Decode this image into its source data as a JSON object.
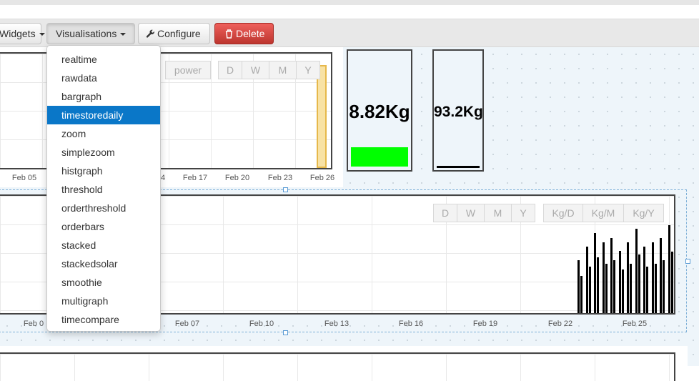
{
  "toolbar": {
    "widgets_label": "Widgets",
    "visualisations_label": "Visualisations",
    "configure_label": "Configure",
    "delete_label": "Delete"
  },
  "dropdown": {
    "items": [
      "realtime",
      "rawdata",
      "bargraph",
      "timestoredaily",
      "zoom",
      "simplezoom",
      "histgraph",
      "threshold",
      "orderthreshold",
      "orderbars",
      "stacked",
      "stackedsolar",
      "smoothie",
      "multigraph",
      "timecompare"
    ],
    "selected": "timestoredaily"
  },
  "graph1": {
    "power_label": "power",
    "range_buttons": [
      "D",
      "W",
      "M",
      "Y"
    ],
    "x_ticks": [
      "Feb 05",
      "Feb 14",
      "Feb 17",
      "Feb 20",
      "Feb 23",
      "Feb 26"
    ],
    "tick_4_visible": "4"
  },
  "feeds": [
    {
      "value": "8.82Kg",
      "bar_color": "#00ff00",
      "level": 0.35
    },
    {
      "value": "93.2Kg",
      "bar_color": "#000000",
      "level": 0.02
    }
  ],
  "graph2": {
    "range_buttons": [
      "D",
      "W",
      "M",
      "Y"
    ],
    "unit_buttons": [
      "Kg/D",
      "Kg/M",
      "Kg/Y"
    ],
    "x_ticks": [
      "Feb 0",
      "Feb 07",
      "Feb 10",
      "Feb 13",
      "Feb 16",
      "Feb 19",
      "Feb 22",
      "Feb 25"
    ]
  },
  "colors": {
    "accent": "#0a77c8",
    "danger": "#d9534f",
    "plot_border": "#444444"
  },
  "chart_data": {
    "type": "bar",
    "title": "",
    "xlabel": "",
    "ylabel": "",
    "x_ticks": [
      "Feb 07",
      "Feb 10",
      "Feb 13",
      "Feb 16",
      "Feb 19",
      "Feb 22",
      "Feb 25"
    ],
    "series": [
      {
        "x": [
          "Feb 23",
          "Feb 23",
          "Feb 23",
          "Feb 24",
          "Feb 24",
          "Feb 24",
          "Feb 25",
          "Feb 25",
          "Feb 25",
          "Feb 26",
          "Feb 26",
          "Feb 26"
        ],
        "values": [
          0.6,
          0.75,
          0.9,
          0.8,
          0.85,
          0.7,
          0.8,
          0.95,
          0.75,
          0.8,
          0.85,
          0.99
        ]
      }
    ]
  }
}
